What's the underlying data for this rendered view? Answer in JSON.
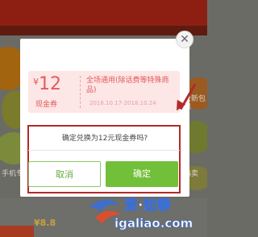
{
  "background": {
    "left_label": "手机专享",
    "right_label_top": "全新包邮",
    "right_label_bottom": "热卖",
    "price_fragment": "¥8.8"
  },
  "modal": {
    "close_icon": "close-icon",
    "coupon": {
      "currency": "¥",
      "amount": "12",
      "type_label": "现金券",
      "title": "全场通用(除话费等特殊商品)",
      "validity": "2018.10.17-2018.10.24"
    },
    "confirm_text": "确定兑换为12元现金券吗?",
    "cancel_label": "取消",
    "ok_label": "确定"
  },
  "watermark": {
    "brand": "爱·尬聊",
    "url": "igaliao.com"
  },
  "colors": {
    "accent_green": "#72bf3a",
    "coupon_pink": "#fde6e6",
    "coupon_red": "#e45b5b",
    "annotation_red": "#b32a2a"
  }
}
